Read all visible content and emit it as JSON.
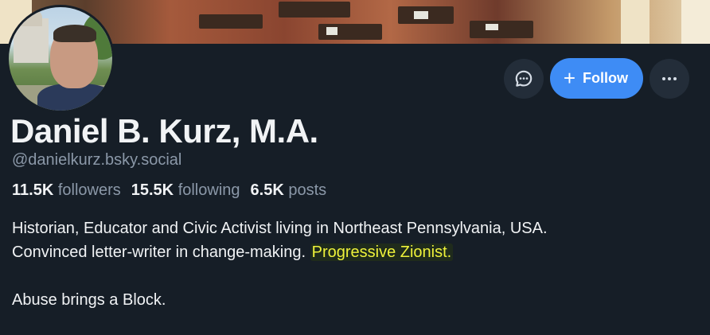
{
  "profile": {
    "display_name": "Daniel B. Kurz, M.A.",
    "handle": "@danielkurz.bsky.social",
    "stats": {
      "followers_count": "11.5K",
      "followers_label": "followers",
      "following_count": "15.5K",
      "following_label": "following",
      "posts_count": "6.5K",
      "posts_label": "posts"
    },
    "bio": {
      "line1": "Historian, Educator and Civic Activist living in Northeast Pennsylvania, USA.",
      "line2_prefix": "Convinced letter-writer in change-making. ",
      "line2_highlight": "Progressive Zionist.",
      "line3": "Abuse brings a Block."
    }
  },
  "actions": {
    "follow_label": "Follow",
    "message_icon": "chat-bubble-icon",
    "more_icon": "more-horizontal-icon"
  },
  "colors": {
    "background": "#161e27",
    "follow_button": "#3e8cf5",
    "muted_text": "#8b98a8",
    "highlight_text": "#eef23a"
  }
}
